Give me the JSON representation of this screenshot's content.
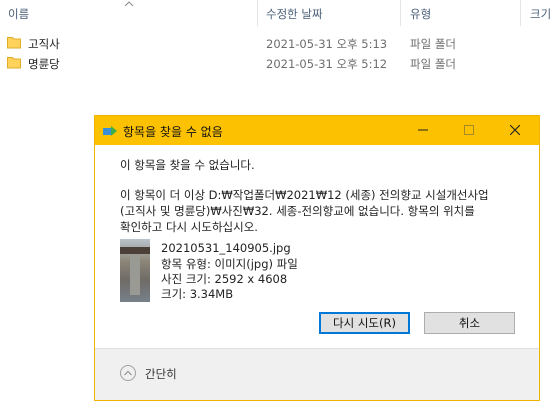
{
  "file_list": {
    "columns": [
      "이름",
      "수정한 날짜",
      "유형",
      "크기"
    ],
    "rows": [
      {
        "name": "고직사",
        "modified": "2021-05-31 오후 5:13",
        "type": "파일 폴더"
      },
      {
        "name": "명륜당",
        "modified": "2021-05-31 오후 5:12",
        "type": "파일 폴더"
      }
    ]
  },
  "dialog": {
    "title": "항목을 찾을 수 없음",
    "heading": "이 항목을 찾을 수 없습니다.",
    "message_lines": [
      "이 항목이 더 이상 D:₩작업폴더₩2021₩12 (세종) 전의향교 시설개선사업",
      "(고직사 및 명륜당)₩사진₩32. 세종-전의향교에 없습니다. 항목의 위치를",
      "확인하고 다시 시도하십시오."
    ],
    "file_info": {
      "filename": "20210531_140905.jpg",
      "item_type": "항목 유형: 이미지(jpg) 파일",
      "dimensions": "사진 크기: 2592 x 4608",
      "size": "크기: 3.34MB"
    },
    "retry_label": "다시 시도(R)",
    "cancel_label": "취소",
    "collapse_label": "간단히"
  },
  "colors": {
    "titlebar": "#fcc100",
    "folder": "#ffd35b",
    "primary_border": "#0078d7"
  },
  "icons": [
    "sort-up-icon",
    "folder-icon",
    "move-file-icon",
    "minimize-icon",
    "maximize-icon",
    "close-icon",
    "chevron-up-icon"
  ]
}
